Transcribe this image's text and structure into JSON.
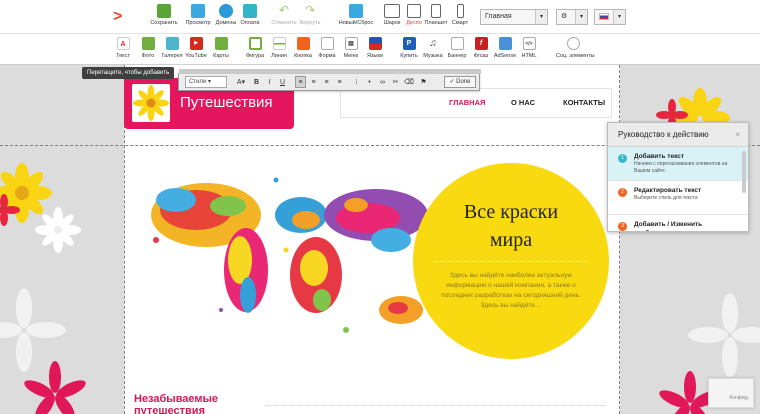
{
  "toolbar": {
    "save": "Сохранить",
    "preview": "Просмотр",
    "domains": "Домены",
    "payment": "Оплата",
    "undo": "Отменить",
    "redo": "Вернуть",
    "new_reset": "Новый/Сброс",
    "device_wide": "Шарок",
    "device_desktop": "Деспо",
    "device_tablet": "Планшет",
    "device_phone": "Смарт",
    "page_select": "Главная"
  },
  "elements": {
    "text": "Текст",
    "photo": "Фото",
    "gallery": "Галерея",
    "youtube": "YouTube",
    "maps": "Карты",
    "shape": "Фигура",
    "line": "Линия",
    "button": "Кнопка",
    "form": "Форма",
    "menu": "Меню",
    "languages": "Языки",
    "buy": "Купить",
    "music": "Музыка",
    "banner": "Баннер",
    "flash": "Флэш",
    "adsense": "AdSense",
    "html": "HTML",
    "social": "Соц. элементы"
  },
  "tooltip": "Перетащите, чтобы добавить",
  "format_bar": {
    "styles": "Стили",
    "font_size_label": "A",
    "bold": "B",
    "italic": "I",
    "underline": "U",
    "done": "Done"
  },
  "site": {
    "logo_title": "Путешествия",
    "nav": [
      "ГЛАВНАЯ",
      "О НАС",
      "КОНТАКТЫ"
    ],
    "hero_title_1": "Все краски",
    "hero_title_2": "мира",
    "hero_desc": "Здесь вы найдёте наиболее актуальную информацию о нашей компании, а также о последних разработках на сегодняшний день. Здесь вы найдёте…",
    "section_title_1": "Незабываемые",
    "section_title_2": "путешествия"
  },
  "guide": {
    "title": "Руководство к действию",
    "close": "×",
    "steps": [
      {
        "num": "1",
        "title": "Добавить текст",
        "desc": "Начнем с перетаскивания элементов на Вашем сайте"
      },
      {
        "num": "2",
        "title": "Редактировать текст",
        "desc": "Выберите стиль для текста"
      },
      {
        "num": "3",
        "title": "Добавить / Изменить изображение",
        "desc": ""
      }
    ]
  },
  "colors": {
    "accent_pink": "#e4175e",
    "hero_yellow": "#f9d90f",
    "guide_active": "#d8f2f6"
  },
  "recaptcha": "Конфид."
}
